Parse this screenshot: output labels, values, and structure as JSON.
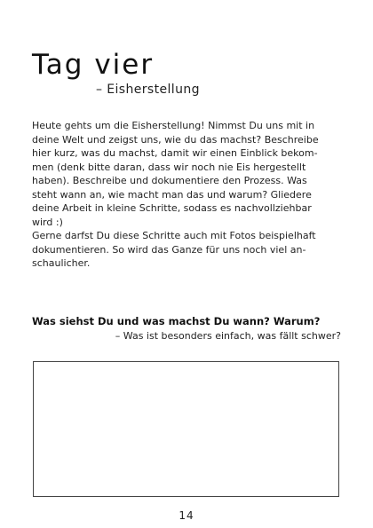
{
  "header": {
    "title": "Tag vier",
    "subtitle": "– Eisherstellung"
  },
  "body": {
    "lines": [
      "Heute gehts um die Eisherstellung! Nimmst Du uns mit in",
      "deine Welt und zeigst uns, wie du das machst? Beschreibe",
      "hier kurz, was du machst, damit wir einen Einblick bekom-",
      "men (denk bitte daran, dass wir noch nie Eis hergestellt",
      "haben). Beschreibe und dokumentiere den Prozess. Was",
      "steht wann an, wie macht man das und warum? Gliedere",
      "deine Arbeit in kleine Schritte, sodass es nachvollziehbar",
      "wird :)",
      "Gerne darfst Du diese Schritte auch mit Fotos beispielhaft",
      "dokumentieren. So wird das Ganze für uns noch viel an-",
      "schaulicher."
    ]
  },
  "question": {
    "main": "Was siehst Du und was machst Du wann? Warum?",
    "sub": "– Was ist besonders einfach, was fällt schwer?"
  },
  "footer": {
    "page_number": "14"
  }
}
